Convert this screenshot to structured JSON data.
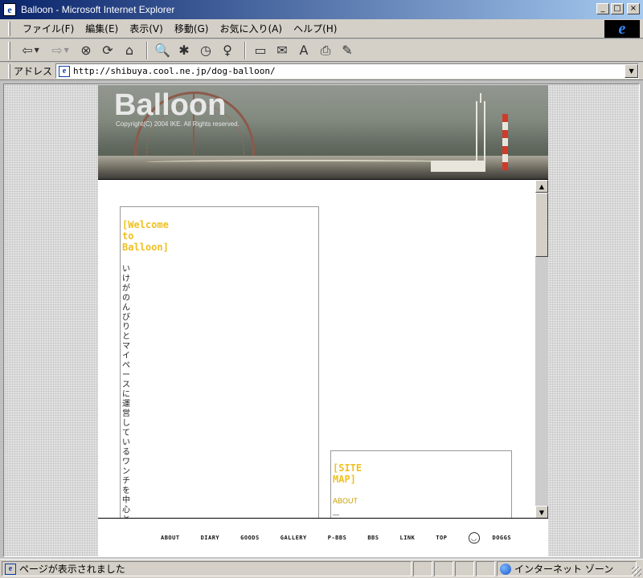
{
  "window": {
    "title": "Balloon - Microsoft Internet Explorer",
    "controls": {
      "minimize": "_",
      "maximize": "□",
      "close": "×"
    }
  },
  "menu": {
    "items": [
      "ファイル(F)",
      "編集(E)",
      "表示(V)",
      "移動(G)",
      "お気に入り(A)",
      "ヘルプ(H)"
    ]
  },
  "brand": {
    "logo": "e"
  },
  "toolbar": {
    "buttons": [
      {
        "name": "back",
        "glyph": "⇦"
      },
      {
        "name": "forward",
        "glyph": "⇨"
      },
      {
        "name": "stop",
        "glyph": "⊗"
      },
      {
        "name": "refresh",
        "glyph": "⟳"
      },
      {
        "name": "home",
        "glyph": "⌂"
      },
      {
        "name": "search",
        "glyph": "🔍"
      },
      {
        "name": "favorites",
        "glyph": "✱"
      },
      {
        "name": "history",
        "glyph": "◷"
      },
      {
        "name": "channels",
        "glyph": "♀"
      },
      {
        "name": "fullscreen",
        "glyph": "▭"
      },
      {
        "name": "mail",
        "glyph": "✉"
      },
      {
        "name": "font",
        "glyph": "A"
      },
      {
        "name": "print",
        "glyph": "⎙"
      },
      {
        "name": "edit",
        "glyph": "✎"
      }
    ]
  },
  "address": {
    "label": "アドレス",
    "url": "http://shibuya.cool.ne.jp/dog-balloon/"
  },
  "page": {
    "site_title": "Balloon",
    "copyright": "Copyright(C) 2004 IKE. All Rights reserved.",
    "welcome": {
      "title": "[Welcome\nto\nBalloon]",
      "body": "いけがのんびりとマイペースに運営しているワンチを中心とした趣"
    },
    "sitemap": {
      "title": "[SITE\nMAP]",
      "first_link": "ABOUT"
    },
    "nav": [
      "ABOUT",
      "DIARY",
      "GOODS",
      "GALLERY",
      "P-BBS",
      "BBS",
      "LINK",
      "TOP",
      "DOGGS"
    ]
  },
  "status": {
    "text": "ページが表示されました",
    "zone": "インターネット ゾーン"
  }
}
